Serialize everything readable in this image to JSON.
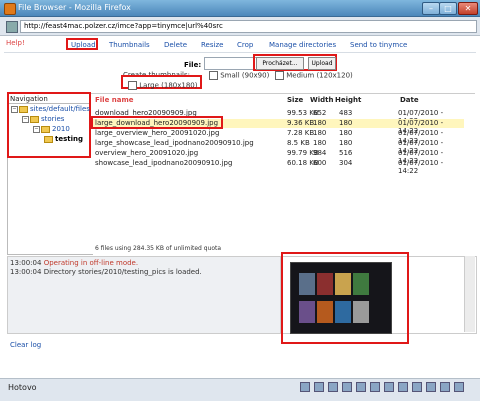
{
  "window": {
    "title": "File Browser - Mozilla Firefox"
  },
  "url": "http://feast4mac.polzer.cz/imce?app=tinymce|url%40src",
  "help": "Help!",
  "tabs": [
    "Upload",
    "Thumbnails",
    "Delete",
    "Resize",
    "Crop",
    "Manage directories",
    "Send to tinymce"
  ],
  "upload": {
    "file_label": "File:",
    "browse": "Procházet...",
    "upload": "Upload"
  },
  "thumbs": {
    "label": "Create thumbnails:",
    "small": "Small (90x90)",
    "medium": "Medium (120x120)",
    "large": "Large (180x180)"
  },
  "nav": {
    "label": "Navigation",
    "items": [
      "sites/default/files",
      "stories",
      "2010",
      "testing"
    ]
  },
  "list": {
    "headers": {
      "name": "File name",
      "size": "Size",
      "width": "Width",
      "height": "Height",
      "date": "Date"
    },
    "rows": [
      {
        "name": "download_hero20090909.jpg",
        "size": "99.53 KB",
        "width": "652",
        "height": "483",
        "date": "01/07/2010 - 14:22"
      },
      {
        "name": "large_download_hero20090909.jpg",
        "size": "9.36 KB",
        "width": "180",
        "height": "180",
        "date": "01/07/2010 - 14:22"
      },
      {
        "name": "large_overview_hero_20091020.jpg",
        "size": "7.28 KB",
        "width": "180",
        "height": "180",
        "date": "01/07/2010 - 14:22"
      },
      {
        "name": "large_showcase_lead_ipodnano20090910.jpg",
        "size": "8.5 KB",
        "width": "180",
        "height": "180",
        "date": "01/07/2010 - 14:22"
      },
      {
        "name": "overview_hero_20091020.jpg",
        "size": "99.79 KB",
        "width": "984",
        "height": "516",
        "date": "01/07/2010 - 14:22"
      },
      {
        "name": "showcase_lead_ipodnano20090910.jpg",
        "size": "60.18 KB",
        "width": "600",
        "height": "304",
        "date": "01/07/2010 - 14:22"
      }
    ],
    "summary": "6 files using 284.35 KB of unlimited quota"
  },
  "log": [
    {
      "time": "13:00:04",
      "msg": "Operating in off-line mode."
    },
    {
      "time": "13:00:04",
      "msg": "Directory stories/2010/testing_pics is loaded."
    }
  ],
  "clear_log": "Clear log",
  "status": "Hotovo"
}
